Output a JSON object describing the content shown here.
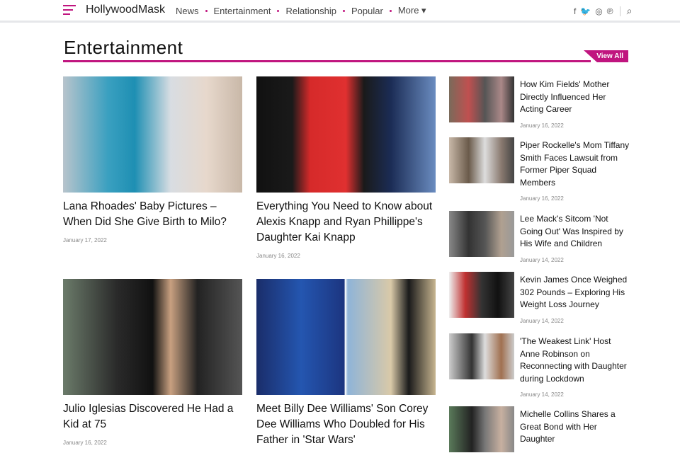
{
  "header": {
    "logo": "HollywoodMask",
    "nav": [
      "News",
      "Entertainment",
      "Relationship",
      "Popular",
      "More ▾"
    ],
    "social": [
      "f",
      "🐦",
      "◎",
      "℗"
    ],
    "search": "⌕"
  },
  "section": {
    "title": "Entertainment",
    "view_all": "View All"
  },
  "colors": {
    "accent": "#c0157f"
  },
  "cards": [
    {
      "title": "Lana Rhoades' Baby Pictures – When Did She Give Birth to Milo?",
      "date": "January 17, 2022"
    },
    {
      "title": "Everything You Need to Know about Alexis Knapp and Ryan Phillippe's Daughter Kai Knapp",
      "date": "January 16, 2022"
    },
    {
      "title": "Julio Iglesias Discovered He Had a Kid at 75",
      "date": "January 16, 2022"
    },
    {
      "title": "Meet Billy Dee Williams' Son Corey Dee Williams Who Doubled for His Father in 'Star Wars'",
      "date": ""
    }
  ],
  "sidebar": [
    {
      "title": "How Kim Fields' Mother Directly Influenced Her Acting Career",
      "date": "January 16, 2022"
    },
    {
      "title": "Piper Rockelle's Mom Tiffany Smith Faces Lawsuit from Former Piper Squad Members",
      "date": "January 16, 2022"
    },
    {
      "title": "Lee Mack's Sitcom 'Not Going Out' Was Inspired by His Wife and Children",
      "date": "January 14, 2022"
    },
    {
      "title": "Kevin James Once Weighed 302 Pounds – Exploring His Weight Loss Journey",
      "date": "January 14, 2022"
    },
    {
      "title": "'The Weakest Link' Host Anne Robinson on Reconnecting with Daughter during Lockdown",
      "date": "January 14, 2022"
    },
    {
      "title": "Michelle Collins Shares a Great Bond with Her Daughter",
      "date": ""
    }
  ]
}
